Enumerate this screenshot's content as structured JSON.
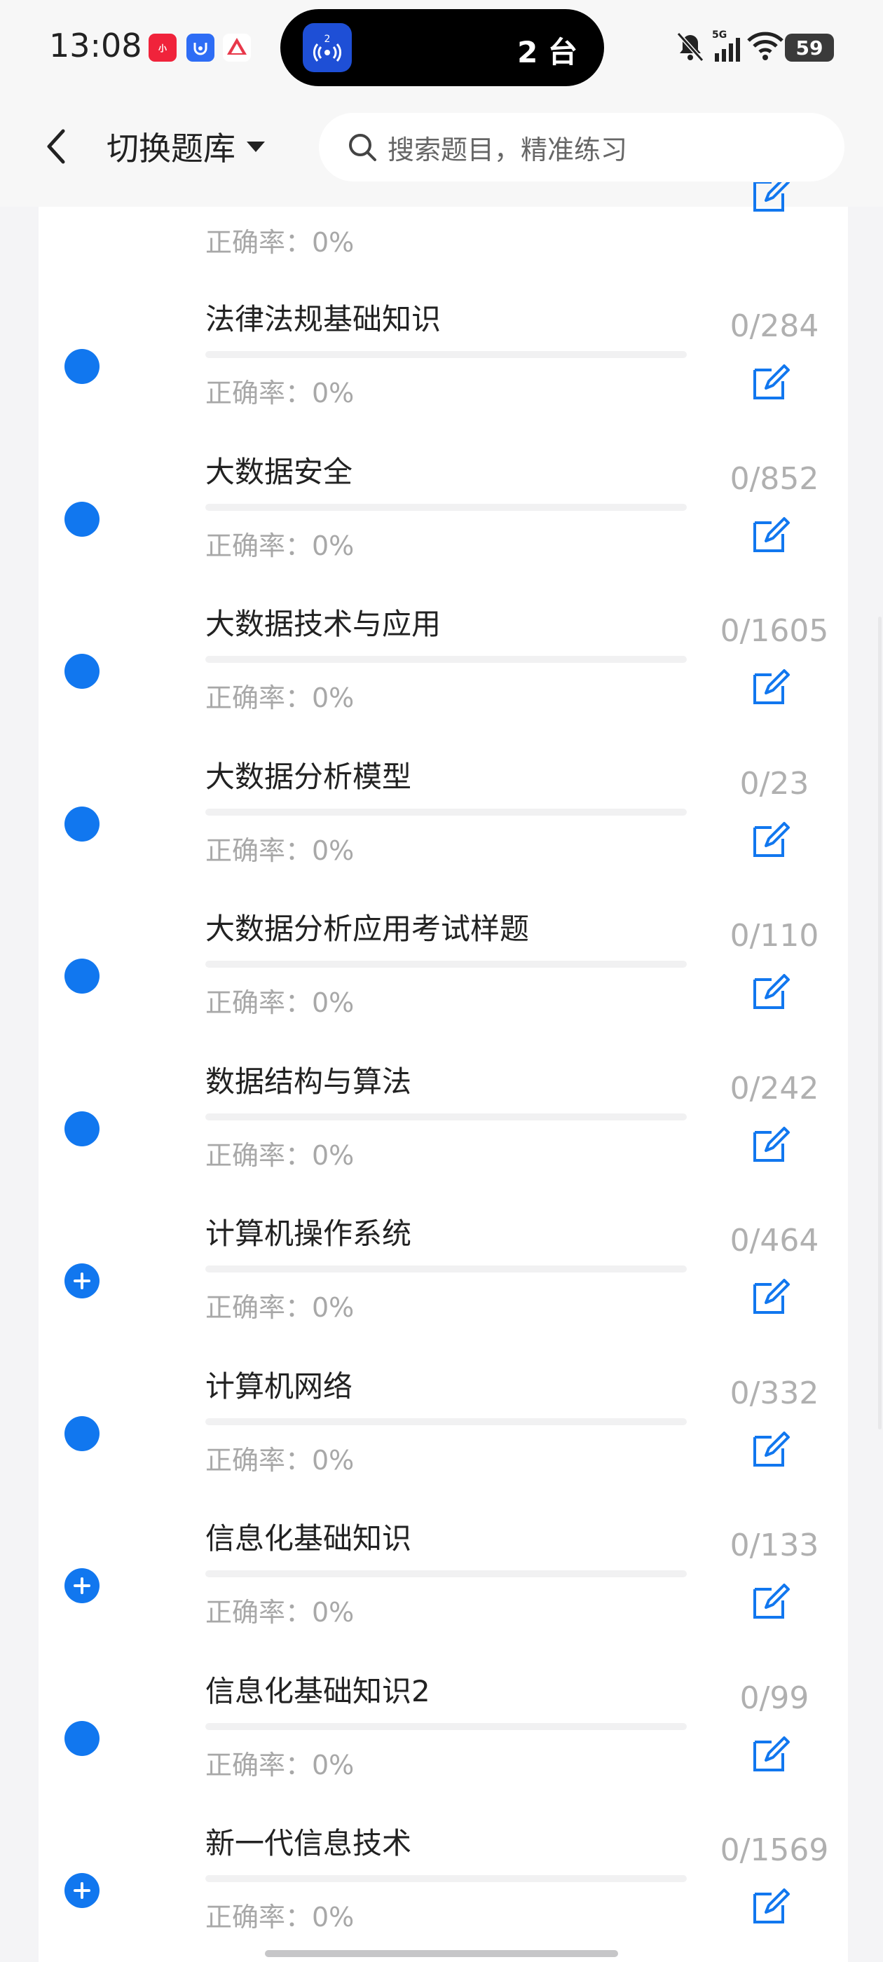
{
  "status_bar": {
    "time": "13:08",
    "island_text": "2 台",
    "battery": "59",
    "network": "5G"
  },
  "header": {
    "switch_label": "切换题库",
    "search_placeholder": "搜索题目，精准练习"
  },
  "colors": {
    "accent": "#1177ef",
    "muted_text": "#a8a8a8",
    "count_text": "#b0b0b0"
  },
  "partial_row": {
    "accuracy": "正确率：0%"
  },
  "items": [
    {
      "title": "法律法规基础知识",
      "count": "0/284",
      "accuracy": "正确率：0%",
      "icon": "dot",
      "progress": 0
    },
    {
      "title": "大数据安全",
      "count": "0/852",
      "accuracy": "正确率：0%",
      "icon": "dot",
      "progress": 0
    },
    {
      "title": "大数据技术与应用",
      "count": "0/1605",
      "accuracy": "正确率：0%",
      "icon": "dot",
      "progress": 0
    },
    {
      "title": "大数据分析模型",
      "count": "0/23",
      "accuracy": "正确率：0%",
      "icon": "dot",
      "progress": 0
    },
    {
      "title": "大数据分析应用考试样题",
      "count": "0/110",
      "accuracy": "正确率：0%",
      "icon": "dot",
      "progress": 0
    },
    {
      "title": "数据结构与算法",
      "count": "0/242",
      "accuracy": "正确率：0%",
      "icon": "dot",
      "progress": 0
    },
    {
      "title": "计算机操作系统",
      "count": "0/464",
      "accuracy": "正确率：0%",
      "icon": "plus",
      "progress": 0
    },
    {
      "title": "计算机网络",
      "count": "0/332",
      "accuracy": "正确率：0%",
      "icon": "dot",
      "progress": 0
    },
    {
      "title": "信息化基础知识",
      "count": "0/133",
      "accuracy": "正确率：0%",
      "icon": "plus",
      "progress": 0
    },
    {
      "title": "信息化基础知识2",
      "count": "0/99",
      "accuracy": "正确率：0%",
      "icon": "dot",
      "progress": 0
    },
    {
      "title": "新一代信息技术",
      "count": "0/1569",
      "accuracy": "正确率：0%",
      "icon": "plus",
      "progress": 0
    }
  ]
}
